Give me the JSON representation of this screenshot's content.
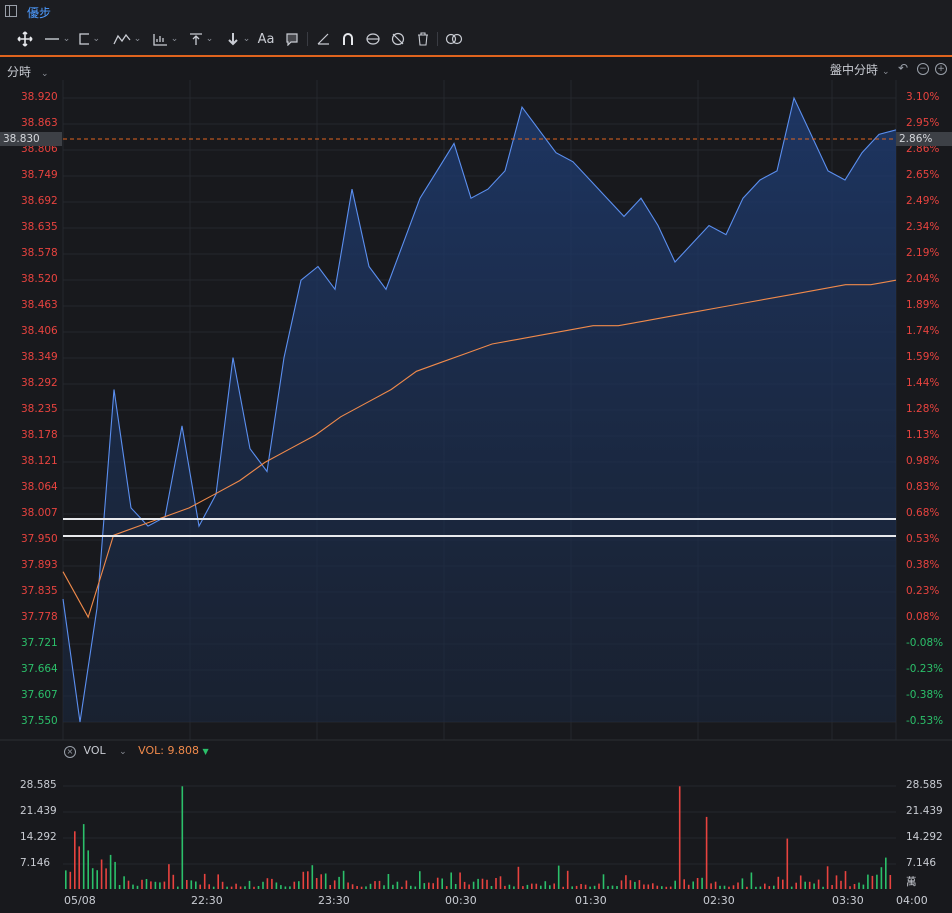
{
  "app": {
    "title": "優步"
  },
  "toolbar": {
    "items": [
      "move-tool",
      "line-tool",
      "rect-tool",
      "path-tool",
      "fib-tool",
      "range-tool",
      "arrow-tool",
      "text-tool",
      "note-tool",
      "angle-tool",
      "magnet-tool",
      "eye-tool",
      "hide-tool",
      "delete-tool",
      "link-tool"
    ],
    "text_label": "Aa"
  },
  "chart": {
    "period_label": "分時",
    "mode_label": "盤中分時",
    "current_price": "38.830",
    "current_pct": "2.86%",
    "left_axis": [
      "38.920",
      "38.863",
      "38.806",
      "38.749",
      "38.692",
      "38.635",
      "38.578",
      "38.520",
      "38.463",
      "38.406",
      "38.349",
      "38.292",
      "38.235",
      "38.178",
      "38.121",
      "38.064",
      "38.007",
      "37.950",
      "37.893",
      "37.835",
      "37.778",
      "37.721",
      "37.664",
      "37.607",
      "37.550"
    ],
    "right_axis": [
      "3.10%",
      "2.95%",
      "2.86%",
      "2.65%",
      "2.49%",
      "2.34%",
      "2.19%",
      "2.04%",
      "1.89%",
      "1.74%",
      "1.59%",
      "1.44%",
      "1.28%",
      "1.13%",
      "0.98%",
      "0.83%",
      "0.68%",
      "0.53%",
      "0.38%",
      "0.23%",
      "0.08%",
      "-0.08%",
      "-0.23%",
      "-0.38%",
      "-0.53%"
    ],
    "colors": {
      "up": "#e8433f",
      "down": "#2bc06a",
      "price_line": "#5b8ff0",
      "avg_line": "#f08a4b",
      "accent": "#e0641e"
    }
  },
  "volume": {
    "label": "VOL",
    "value_label": "VOL: 9.808",
    "axis_left": [
      "28.585",
      "21.439",
      "14.292",
      "7.146"
    ],
    "axis_right": [
      "28.585",
      "21.439",
      "14.292",
      "7.146",
      "萬"
    ]
  },
  "x_axis": [
    "05/08",
    "22:30",
    "23:30",
    "00:30",
    "01:30",
    "02:30",
    "03:30",
    "04:00"
  ],
  "chart_data": {
    "type": "line",
    "title": "",
    "series": [
      {
        "name": "",
        "values": [
          37.82,
          37.55,
          37.8,
          38.28,
          38.02,
          37.98,
          38.0,
          38.2,
          37.98,
          38.05,
          38.35,
          38.15,
          38.1,
          38.35,
          38.52,
          38.55,
          38.5,
          38.72,
          38.55,
          38.5,
          38.6,
          38.7,
          38.76,
          38.82,
          38.7,
          38.72,
          38.76,
          38.9,
          38.85,
          38.8,
          38.78,
          38.74,
          38.7,
          38.66,
          38.7,
          38.64,
          38.56,
          38.6,
          38.64,
          38.62,
          38.7,
          38.74,
          38.76,
          38.92,
          38.84,
          38.76,
          38.74,
          38.8,
          38.84,
          38.85
        ]
      },
      {
        "name": "",
        "values": [
          37.88,
          37.78,
          37.96,
          37.98,
          38.0,
          38.02,
          38.05,
          38.08,
          38.12,
          38.15,
          38.18,
          38.22,
          38.25,
          38.28,
          38.32,
          38.34,
          38.36,
          38.38,
          38.39,
          38.4,
          38.41,
          38.42,
          38.42,
          38.43,
          38.44,
          38.45,
          38.46,
          38.47,
          38.48,
          38.49,
          38.5,
          38.51,
          38.51,
          38.52
        ]
      }
    ],
    "ylim": [
      37.55,
      38.92
    ],
    "reference_lines": [
      38.0,
      37.96
    ],
    "volume_ylim": [
      0,
      28.585
    ],
    "volume_unit": "萬"
  }
}
